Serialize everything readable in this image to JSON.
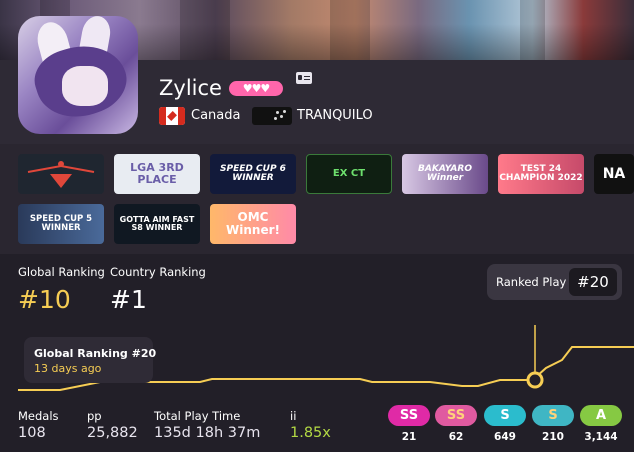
{
  "profile": {
    "username": "Zylice",
    "supporter_hearts": "♥♥♥",
    "country": "Canada",
    "team": "TRANQUILO"
  },
  "badges": [
    {
      "text": "",
      "icon": "trophy-emblem-icon"
    },
    {
      "text": "LGA 3RD PLACE"
    },
    {
      "text": "SPEED CUP 6 WINNER"
    },
    {
      "text": "EX CT"
    },
    {
      "text": "BAKAYARO Winner"
    },
    {
      "text": "TEST 24 CHAMPION 2022"
    },
    {
      "text": "NA"
    },
    {
      "text": "SPEED CUP 5 WINNER"
    },
    {
      "text": "GOTTA AIM FAST S8 WINNER"
    },
    {
      "text": "OMC Winner!"
    }
  ],
  "ranking": {
    "global_label": "Global Ranking",
    "global_value": "#10",
    "country_label": "Country Ranking",
    "country_value": "#1",
    "ranked_play_label": "Ranked Play",
    "ranked_play_value": "#20"
  },
  "tooltip": {
    "title": "Global Ranking #20",
    "subtitle": "13 days ago"
  },
  "stats": {
    "medals_label": "Medals",
    "medals_value": "108",
    "pp_label": "pp",
    "pp_value": "25,882",
    "playtime_label": "Total Play Time",
    "playtime_value": "135d 18h 37m",
    "ii_label": "ii",
    "ii_value": "1.85x"
  },
  "grades": [
    {
      "label": "SS",
      "count": "21",
      "color": "#e02aa6"
    },
    {
      "label": "SS",
      "count": "62",
      "color": "#e05aa0"
    },
    {
      "label": "S",
      "count": "649",
      "color": "#2bbccd"
    },
    {
      "label": "S",
      "count": "210",
      "color": "#3fb6c4"
    },
    {
      "label": "A",
      "count": "3,144",
      "color": "#86c943"
    }
  ],
  "colors": {
    "accent_yellow": "#f6cd54",
    "ii_green": "#b3d944",
    "pink": "#ff66ab"
  }
}
